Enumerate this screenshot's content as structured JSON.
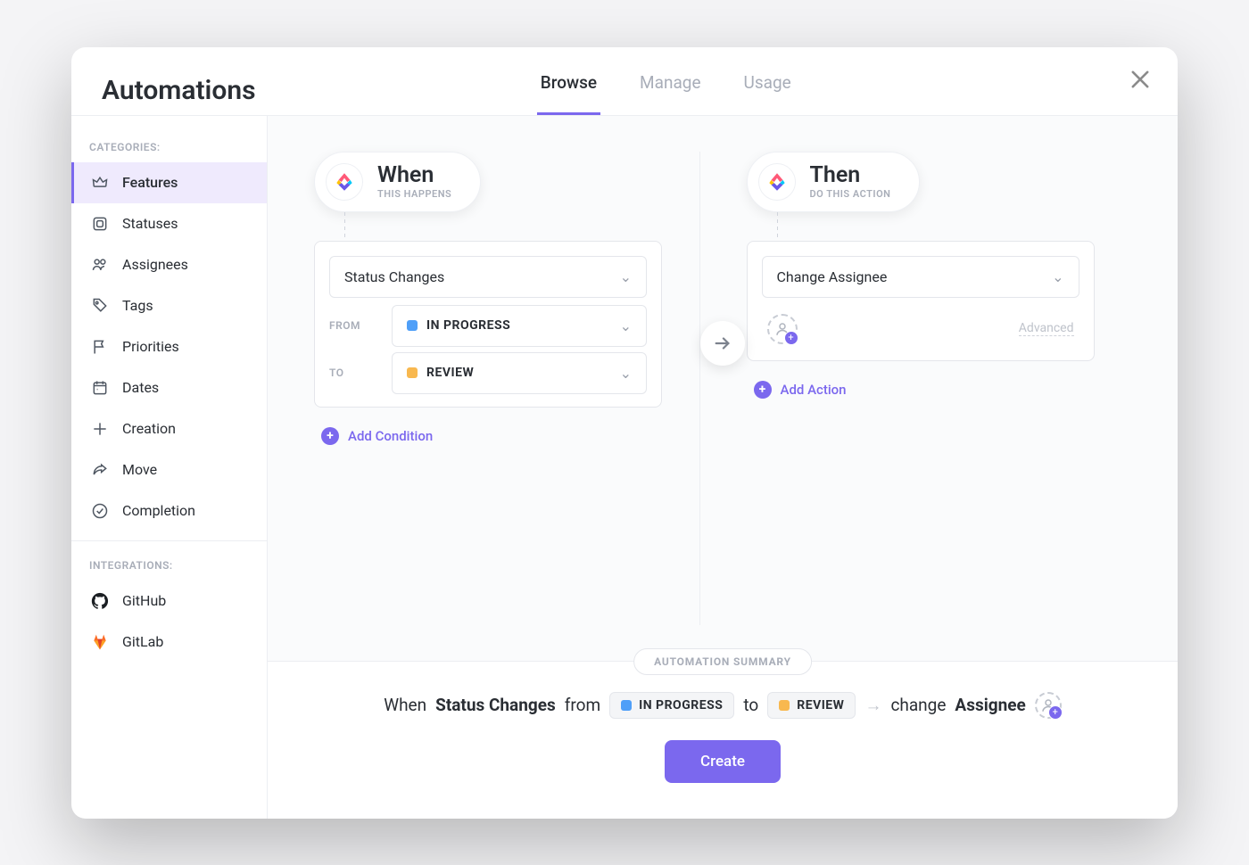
{
  "header": {
    "title": "Automations",
    "tabs": {
      "browse": "Browse",
      "manage": "Manage",
      "usage": "Usage"
    }
  },
  "sidebar": {
    "sections": {
      "categories": {
        "heading": "CATEGORIES:",
        "items": {
          "features": "Features",
          "statuses": "Statuses",
          "assignees": "Assignees",
          "tags": "Tags",
          "priorities": "Priorities",
          "dates": "Dates",
          "creation": "Creation",
          "move": "Move",
          "completion": "Completion"
        }
      },
      "integrations": {
        "heading": "INTEGRATIONS:",
        "items": {
          "github": "GitHub",
          "gitlab": "GitLab"
        }
      }
    }
  },
  "when": {
    "title": "When",
    "subtitle": "THIS HAPPENS",
    "trigger": "Status Changes",
    "from_label": "FROM",
    "from_status": "IN PROGRESS",
    "from_color": "#4f9ff8",
    "to_label": "TO",
    "to_status": "REVIEW",
    "to_color": "#f8b84f",
    "add_condition": "Add Condition"
  },
  "then": {
    "title": "Then",
    "subtitle": "DO THIS ACTION",
    "action": "Change Assignee",
    "advanced": "Advanced",
    "add_action": "Add Action"
  },
  "summary": {
    "heading": "AUTOMATION SUMMARY",
    "w": "When",
    "trigger": "Status Changes",
    "from": "from",
    "from_status": "IN PROGRESS",
    "from_color": "#4f9ff8",
    "to": "to",
    "to_status": "REVIEW",
    "to_color": "#f8b84f",
    "change": "change",
    "assignee": "Assignee",
    "create": "Create"
  }
}
